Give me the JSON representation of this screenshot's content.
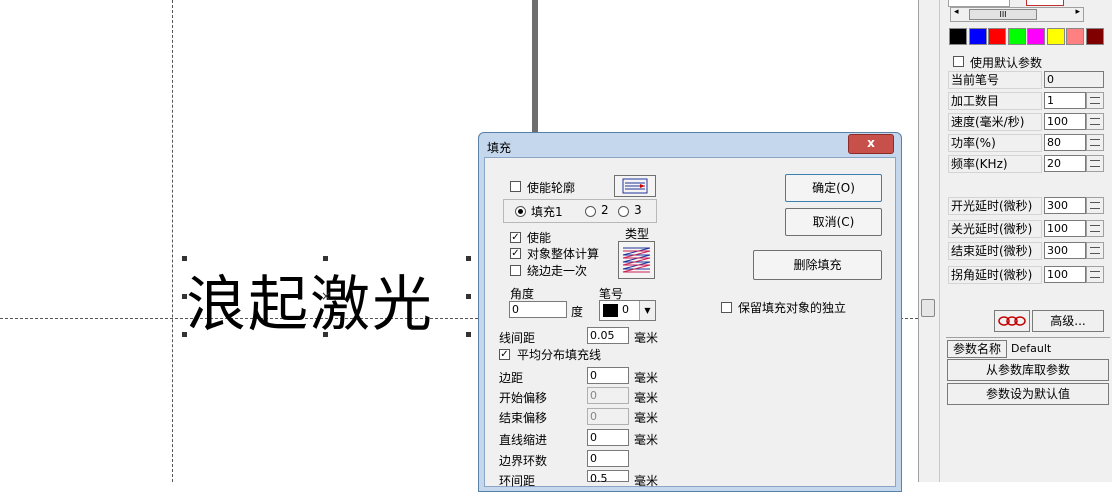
{
  "canvas": {
    "text": "浪起激光"
  },
  "palette": [
    "#000000",
    "#0000ff",
    "#ff0000",
    "#00ff00",
    "#ff00ff",
    "#ffff00",
    "#ff8080",
    "#800000"
  ],
  "panel": {
    "scroll_mid": "III",
    "use_default_label": "使用默认参数",
    "params": [
      {
        "label": "当前笔号",
        "value": "0",
        "spin": false
      },
      {
        "label": "加工数目",
        "value": "1",
        "spin": true
      },
      {
        "label": "速度(毫米/秒)",
        "value": "100",
        "spin": true
      },
      {
        "label": "功率(%)",
        "value": "80",
        "spin": true
      },
      {
        "label": "频率(KHz)",
        "value": "20",
        "spin": true
      }
    ],
    "delays": [
      {
        "label": "开光延时(微秒)",
        "value": "300"
      },
      {
        "label": "关光延时(微秒)",
        "value": "100"
      },
      {
        "label": "结束延时(微秒)",
        "value": "300"
      },
      {
        "label": "拐角延时(微秒)",
        "value": "100"
      }
    ],
    "advanced": "高级...",
    "param_name_label": "参数名称",
    "param_name_value": "Default",
    "from_library": "从参数库取参数",
    "set_default": "参数设为默认值"
  },
  "dialog": {
    "title": "填充",
    "close": "x",
    "enable_outline": "使能轮廓",
    "fill_tabs": [
      "填充1",
      "2",
      "3"
    ],
    "enable": "使能",
    "whole_calc": "对象整体计算",
    "edge_once": "绕边走一次",
    "type_label": "类型",
    "angle_label": "角度",
    "angle_value": "0",
    "angle_unit": "度",
    "pen_label": "笔号",
    "pen_value": "0",
    "line_spacing_label": "线间距",
    "line_spacing_value": "0.05",
    "unit_mm": "毫米",
    "even_distribute": "平均分布填充线",
    "margin_label": "边距",
    "margin_value": "0",
    "start_offset_label": "开始偏移",
    "start_offset_value": "0",
    "end_offset_label": "结束偏移",
    "end_offset_value": "0",
    "line_indent_label": "直线缩进",
    "line_indent_value": "0",
    "loop_count_label": "边界环数",
    "loop_count_value": "0",
    "loop_spacing_label": "环间距",
    "loop_spacing_value": "0.5",
    "ok": "确定(O)",
    "cancel": "取消(C)",
    "delete_fill": "删除填充",
    "keep_independent": "保留填充对象的独立"
  }
}
